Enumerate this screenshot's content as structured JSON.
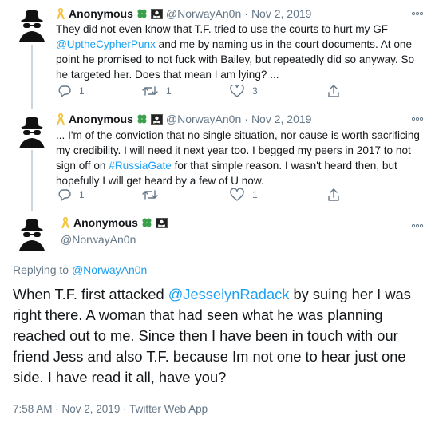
{
  "tweets": [
    {
      "name": "Anonymous",
      "handle": "@NorwayAn0n",
      "dot": "·",
      "date": "Nov 2, 2019",
      "text_parts": [
        "They did not even know that T.F. tried to use the courts to hurt my GF ",
        "@UptheCypherPunx",
        " and me by naming us in the court documents. At one point he promised to not fuck with Bailey, but repeatedly did so anyway. So he targeted her. Does that mean I am lying? ..."
      ],
      "reply_count": "1",
      "retweet_count": "1",
      "like_count": "3",
      "share_count": ""
    },
    {
      "name": "Anonymous",
      "handle": "@NorwayAn0n",
      "dot": "·",
      "date": "Nov 2, 2019",
      "text_parts": [
        "... I'm of the conviction that no single situation, nor cause is worth sacrificing my credibility. I will need it next year too. I begged my peers in 2017 to not sign off on ",
        "#RussiaGate",
        " for that simple reason. I wasn't heard then, but hopefully I will get heard by a few of U now."
      ],
      "reply_count": "1",
      "retweet_count": "",
      "like_count": "1",
      "share_count": ""
    }
  ],
  "main": {
    "name": "Anonymous",
    "handle": "@NorwayAn0n",
    "replying_label": "Replying to ",
    "replying_handle": "@NorwayAn0n",
    "text_parts": [
      "When T.F. first attacked ",
      "@JesselynRadack",
      " by suing her I was right there. A woman that had seen what he was planning reached out to me. Since then I have been in touch with our friend Jess and also T.F. because Im not one to hear just one side. I have read it all, have you?"
    ],
    "meta": "7:58 AM · Nov 2, 2019 · Twitter Web App"
  },
  "colors": {
    "link": "#1da1f2",
    "muted": "#657786",
    "ribbon": "#f4c542",
    "clover": "#3aa14a"
  },
  "icons": [
    "avatar-spy-icon",
    "ribbon-icon",
    "clover-icon",
    "pirate-flag-icon",
    "more-icon",
    "reply-icon",
    "retweet-icon",
    "like-icon",
    "share-icon"
  ]
}
